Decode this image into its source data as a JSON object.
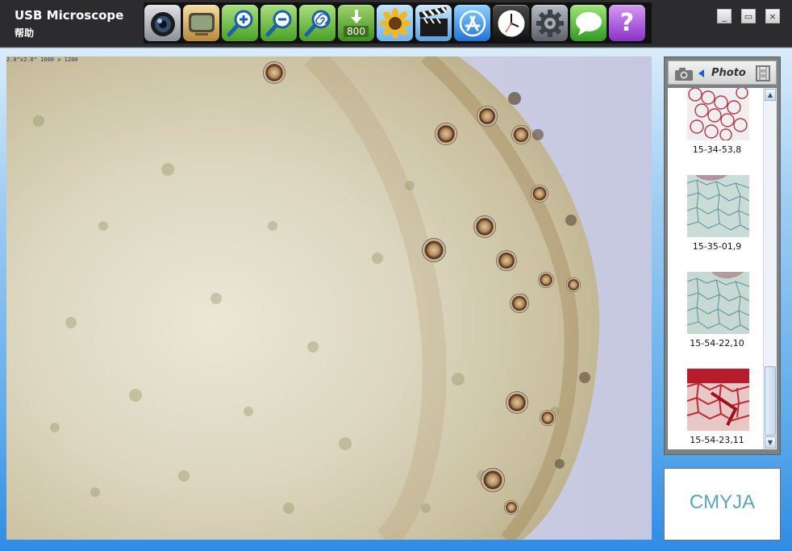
{
  "window": {
    "title": "USB Microscope",
    "menu_help": "帮助",
    "controls": [
      "_",
      "▭",
      "×"
    ]
  },
  "toolbar": {
    "buttons": [
      {
        "name": "camera",
        "icon": "camera-lens-icon"
      },
      {
        "name": "preview",
        "icon": "tv-screen-icon"
      },
      {
        "name": "zoom-in",
        "icon": "zoom-in-icon"
      },
      {
        "name": "zoom-out",
        "icon": "zoom-out-icon"
      },
      {
        "name": "zoom-fit",
        "icon": "zoom-spiral-icon"
      },
      {
        "name": "resolution",
        "icon": "download-arrow-icon",
        "label": "800"
      },
      {
        "name": "image-adjust",
        "icon": "sunflower-icon"
      },
      {
        "name": "video",
        "icon": "clapperboard-icon"
      },
      {
        "name": "app-store",
        "icon": "app-store-icon"
      },
      {
        "name": "timer",
        "icon": "clock-icon"
      },
      {
        "name": "settings",
        "icon": "gear-icon"
      },
      {
        "name": "messages",
        "icon": "chat-bubble-icon"
      },
      {
        "name": "help",
        "icon": "question-icon",
        "label": "?"
      }
    ]
  },
  "viewport": {
    "overlay_text": "2.0\"x2.0\" 1600 x 1200"
  },
  "gallery": {
    "mode_label": "Photo",
    "items": [
      {
        "caption": "15-34-53,8",
        "style": "red-cells"
      },
      {
        "caption": "15-35-01,9",
        "style": "teal-cells"
      },
      {
        "caption": "15-54-22,10",
        "style": "teal-cells"
      },
      {
        "caption": "15-54-23,11",
        "style": "red-dense"
      }
    ]
  },
  "brand": {
    "logo_text": "CMYJA"
  }
}
